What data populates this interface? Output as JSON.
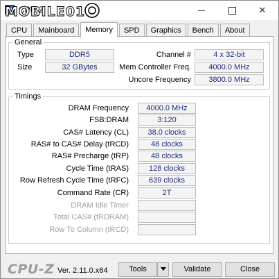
{
  "window": {
    "title": "CPU-Z",
    "watermark_text": "MOBILE01"
  },
  "tabs": [
    {
      "label": "CPU"
    },
    {
      "label": "Mainboard"
    },
    {
      "label": "Memory"
    },
    {
      "label": "SPD"
    },
    {
      "label": "Graphics"
    },
    {
      "label": "Bench"
    },
    {
      "label": "About"
    }
  ],
  "active_tab": "Memory",
  "general": {
    "title": "General",
    "type_label": "Type",
    "type_value": "DDR5",
    "size_label": "Size",
    "size_value": "32 GBytes",
    "channel_label": "Channel #",
    "channel_value": "4 x 32-bit",
    "mem_ctrl_label": "Mem Controller Freq.",
    "mem_ctrl_value": "4000.0 MHz",
    "uncore_label": "Uncore Frequency",
    "uncore_value": "3800.0 MHz"
  },
  "timings": {
    "title": "Timings",
    "rows": [
      {
        "label": "DRAM Frequency",
        "value": "4000.0 MHz"
      },
      {
        "label": "FSB:DRAM",
        "value": "3:120"
      },
      {
        "label": "CAS# Latency (CL)",
        "value": "38.0 clocks"
      },
      {
        "label": "RAS# to CAS# Delay (tRCD)",
        "value": "48 clocks"
      },
      {
        "label": "RAS# Precharge (tRP)",
        "value": "48 clocks"
      },
      {
        "label": "Cycle Time (tRAS)",
        "value": "128 clocks"
      },
      {
        "label": "Row Refresh Cycle Time (tRFC)",
        "value": "639 clocks"
      },
      {
        "label": "Command Rate (CR)",
        "value": "2T"
      },
      {
        "label": "DRAM Idle Timer",
        "value": ""
      },
      {
        "label": "Total CAS# (tRDRAM)",
        "value": ""
      },
      {
        "label": "Row To Column (tRCD)",
        "value": ""
      }
    ]
  },
  "footer": {
    "logo": "CPU-Z",
    "version": "Ver. 2.11.0.x64",
    "tools_label": "Tools",
    "validate_label": "Validate",
    "close_label": "Close"
  },
  "colors": {
    "value_text": "#1c2a80",
    "disabled_text": "#a0a0a0"
  }
}
